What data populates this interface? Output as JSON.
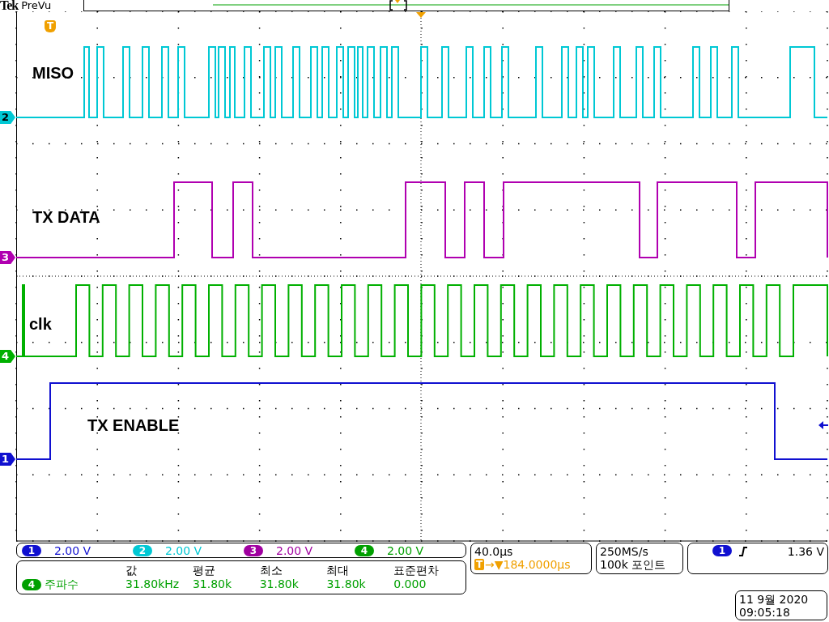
{
  "header": {
    "brand": "Tek",
    "mode": "PreVu"
  },
  "trigger_marker": "T",
  "traces": [
    {
      "kind": "miso",
      "label": "MISO",
      "channel": "2",
      "color": "#00c8d4"
    },
    {
      "kind": "txdata",
      "label": "TX DATA",
      "channel": "3",
      "color": "#b000b0"
    },
    {
      "kind": "clk",
      "label": "clk",
      "channel": "4",
      "color": "#00b000"
    },
    {
      "kind": "enable",
      "label": "TX ENABLE",
      "channel": "1",
      "color": "#1010d0"
    }
  ],
  "channels": [
    {
      "number": "1",
      "scale": "2.00 V",
      "color": "#1010d0"
    },
    {
      "number": "2",
      "scale": "2.00 V",
      "color": "#00c8d4"
    },
    {
      "number": "3",
      "scale": "2.00 V",
      "color": "#a000a0"
    },
    {
      "number": "4",
      "scale": "2.00 V",
      "color": "#00a000"
    }
  ],
  "measurement": {
    "source": "4",
    "name": "주파수",
    "color": "#00a000",
    "columns": [
      {
        "heading": "값",
        "value": "31.80kHz"
      },
      {
        "heading": "평균",
        "value": "31.80k"
      },
      {
        "heading": "최소",
        "value": "31.80k"
      },
      {
        "heading": "최대",
        "value": "31.80k"
      },
      {
        "heading": "표준편차",
        "value": "0.000"
      }
    ]
  },
  "timebase": {
    "scale": "40.0µs",
    "trigger_badge": "T",
    "position": "→▼184.0000µs"
  },
  "acquisition": {
    "rate": "250MS/s",
    "record": "100k 포인트"
  },
  "trigger": {
    "source": "1",
    "color": "#1010d0",
    "level": "1.36 V"
  },
  "datetime": {
    "date": "11 9월 2020",
    "time": "09:05:18"
  }
}
